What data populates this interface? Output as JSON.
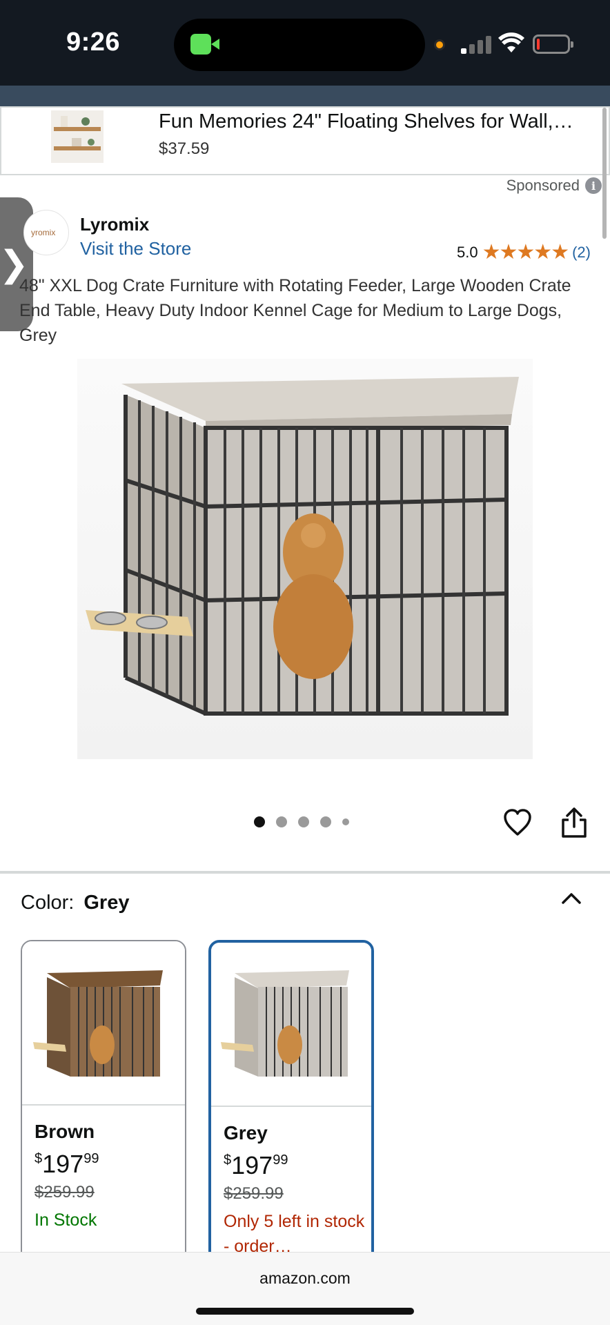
{
  "status_bar": {
    "time": "9:26"
  },
  "sponsored_ad": {
    "title": "Fun Memories 24\" Floating Shelves for Wall,…",
    "price": "$37.59",
    "sponsored_label": "Sponsored"
  },
  "brand": {
    "logo_text": "yromix",
    "name": "Lyromix",
    "visit_store": "Visit the Store",
    "rating": "5.0",
    "stars": "★★★★★",
    "review_count": "(2)"
  },
  "product": {
    "title": "48\" XXL Dog Crate Furniture with Rotating Feeder, Large Wooden Crate End Table, Heavy Duty Indoor Kennel Cage for Medium to Large Dogs, Grey",
    "carousel": {
      "total": 5,
      "active": 0
    }
  },
  "color_selector": {
    "label": "Color:",
    "selected": "Grey",
    "options": [
      {
        "name": "Brown",
        "price_symbol": "$",
        "price_whole": "197",
        "price_cents": "99",
        "old_price": "$259.99",
        "stock": "In Stock",
        "selected": false
      },
      {
        "name": "Grey",
        "price_symbol": "$",
        "price_whole": "197",
        "price_cents": "99",
        "old_price": "$259.99",
        "stock": "Only 5 left in stock - order…",
        "selected": true
      }
    ]
  },
  "browser": {
    "url": "amazon.com"
  },
  "colors": {
    "link": "#2162a1",
    "star": "#de7921",
    "in_stock": "#007600",
    "low_stock": "#b12704",
    "header": "#131921"
  }
}
